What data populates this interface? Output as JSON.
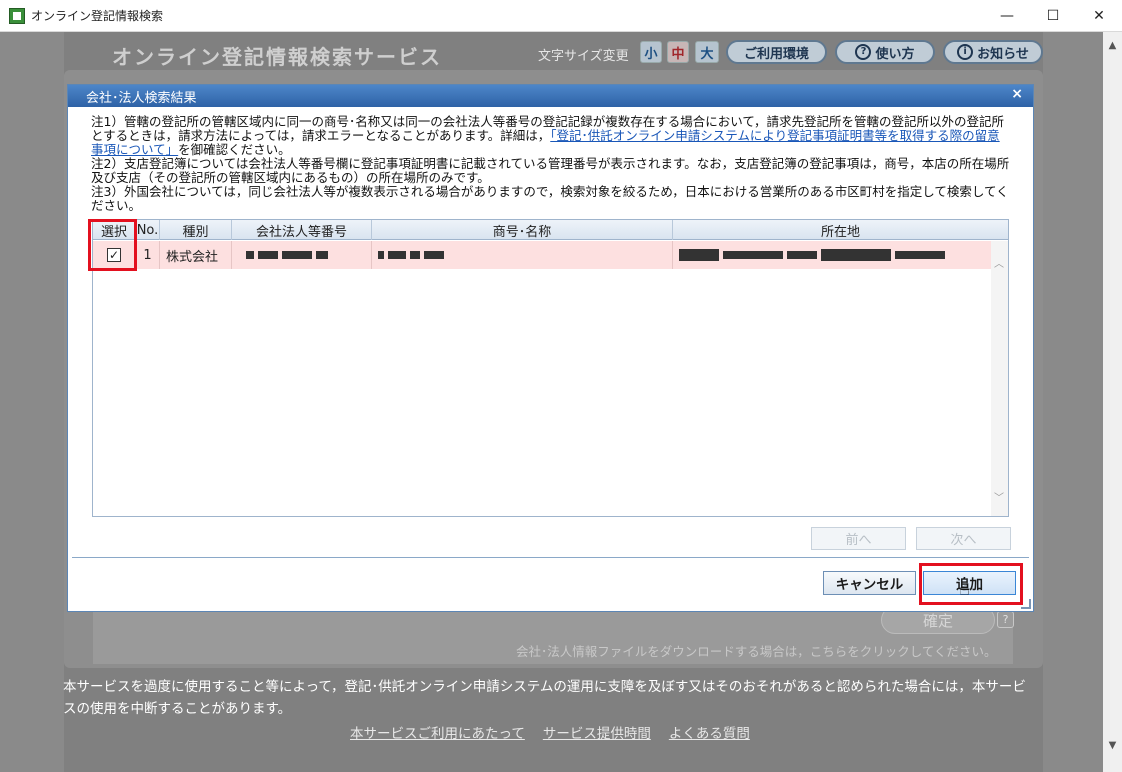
{
  "window": {
    "title": "オンライン登記情報検索",
    "controls": [
      "—",
      "☐",
      "✕"
    ]
  },
  "header": {
    "service_title": "オンライン登記情報検索サービス",
    "font_size_label": "文字サイズ変更",
    "font_small": "小",
    "font_medium": "中",
    "font_large": "大",
    "env_button": "ご利用環境",
    "help_button": "使い方",
    "news_button": "お知らせ"
  },
  "dialog": {
    "title": "会社･法人検索結果",
    "close": "×",
    "notes": {
      "note1_prefix": "注1）管轄の登記所の管轄区域内に同一の商号･名称又は同一の会社法人等番号の登記記録が複数存在する場合において，請求先登記所を管轄の登記所以外の登記所とするときは，請求方法によっては，請求エラーとなることがあります。詳細は，",
      "note1_link": "「登記･供託オンライン申請システムにより登記事項証明書等を取得する際の留意事項について」",
      "note1_suffix": "を御確認ください。",
      "note2": "注2）支店登記簿については会社法人等番号欄に登記事項証明書に記載されている管理番号が表示されます。なお，支店登記簿の登記事項は，商号，本店の所在場所及び支店（その登記所の管轄区域内にあるもの）の所在場所のみです。",
      "note3": "注3）外国会社については，同じ会社法人等が複数表示される場合がありますので，検索対象を絞るため，日本における営業所のある市区町村を指定して検索してください。"
    },
    "table": {
      "headers": [
        "選択",
        "No.",
        "種別",
        "会社法人等番号",
        "商号･名称",
        "所在地"
      ],
      "rows": [
        {
          "checked": "✓",
          "no": "1",
          "type": "株式会社"
        }
      ]
    },
    "prev_button": "前へ",
    "next_button": "次へ",
    "cancel_button": "キャンセル",
    "add_button": "追加"
  },
  "background": {
    "confirm_button": "確定",
    "confirm_help": "?",
    "download_note": "会社･法人情報ファイルをダウンロードする場合は，こちらをクリックしてください。",
    "footer_text": "本サービスを過度に使用すること等によって，登記･供託オンライン申請システムの運用に支障を及ぼす又はそのおそれがあると認められた場合には，本サービスの使用を中断することがあります。",
    "footer_links": [
      "本サービスご利用にあたって",
      "サービス提供時間",
      "よくある質問"
    ]
  },
  "colors": {
    "dialog_header": "#2e62a6",
    "selected_row": "#fde0e0",
    "highlight": "#e3101f"
  }
}
